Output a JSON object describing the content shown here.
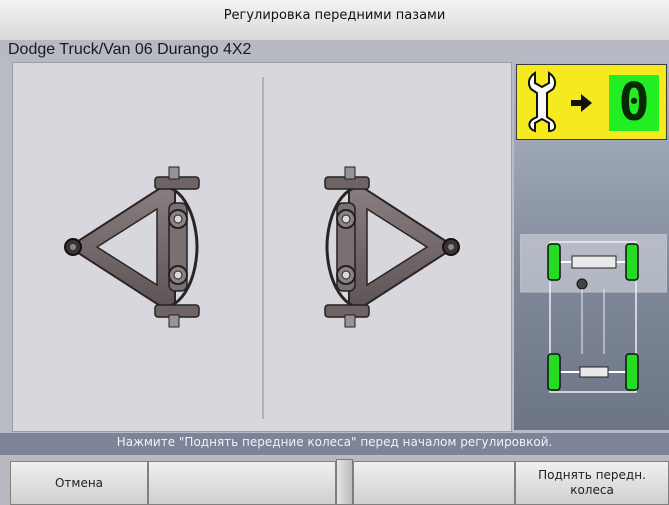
{
  "window": {
    "title": "Регулировка передними пазами"
  },
  "vehicle": {
    "name": "Dodge Truck/Van 06 Durango 4X2"
  },
  "counter": {
    "value": "0",
    "icon": "wrench-icon",
    "arrow": "arrow-right-icon"
  },
  "colors": {
    "counter_bg": "#f4ea1f",
    "counter_value_bg": "#22ee22",
    "wheel": "#22dd22"
  },
  "instruction": {
    "text": "Нажмите \"Поднять передние колеса\" перед началом регулировкой."
  },
  "buttons": {
    "cancel": "Отмена",
    "f2": "",
    "f3": "",
    "raise_wheels": "Поднять передн. колеса"
  }
}
